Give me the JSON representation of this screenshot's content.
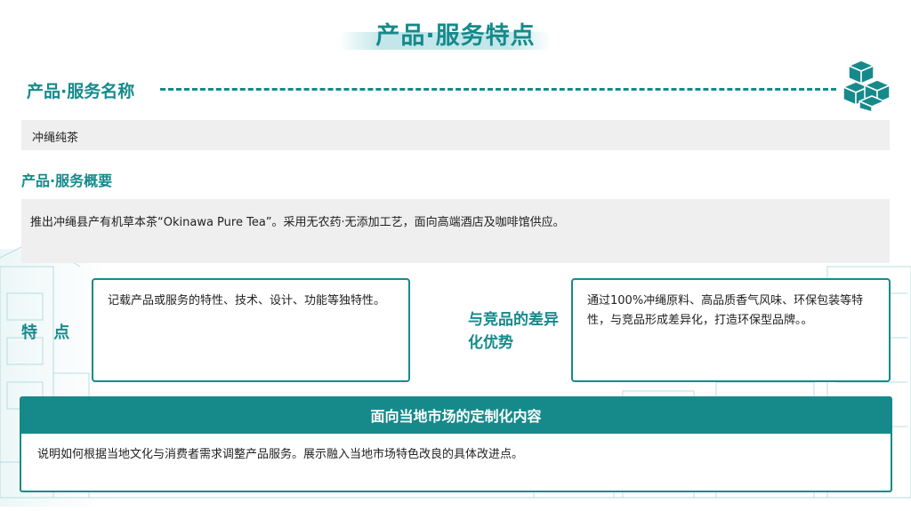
{
  "page": {
    "title": "产品·服务特点"
  },
  "sections": {
    "name": {
      "label": "产品·服务名称",
      "value": "冲绳纯茶"
    },
    "overview": {
      "label": "产品·服务概要",
      "text": "推出冲绳县产有机草本茶“Okinawa Pure Tea”。采用无农药·无添加工艺，面向高端酒店及咖啡馆供应。"
    },
    "features": {
      "label": "特 点",
      "text": "记载产品或服务的特性、技术、设计、功能等独特性。"
    },
    "differentiation": {
      "label": "与竞品的差异化优势",
      "text": "通过100%冲绳原料、高品质香气风味、环保包装等特性，与竞品形成差异化，打造环保型品牌。。"
    },
    "localization": {
      "header": "面向当地市场的定制化内容",
      "text": "说明如何根据当地文化与消费者需求调整产品服务。展示融入当地市场特色改良的具体改进点。"
    }
  },
  "icons": {
    "logo": "stacked-cubes-icon"
  },
  "colors": {
    "accent": "#168a8b",
    "box_gray": "#efefef"
  }
}
